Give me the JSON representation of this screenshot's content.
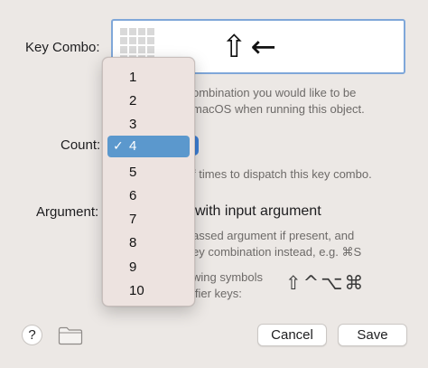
{
  "key_combo": {
    "label": "Key Combo:",
    "symbols": "⇧←",
    "help_lines": [
      "ombination you would like to be",
      "macOS when running this object."
    ]
  },
  "count": {
    "label": "Count:",
    "help": "f times to dispatch this key combo."
  },
  "argument": {
    "label": "Argument:",
    "checkbox_label": "with input argument",
    "help_lines": [
      "assed argument if present, and",
      "ey combination instead, e.g. ⌘S"
    ]
  },
  "symbols": {
    "help_lines": [
      "wing symbols",
      "ifier keys:"
    ],
    "glyphs": "⇧^⌥⌘"
  },
  "footer": {
    "help_label": "?",
    "cancel_label": "Cancel",
    "save_label": "Save"
  },
  "dropdown": {
    "options": [
      "1",
      "2",
      "3",
      "4",
      "5",
      "6",
      "7",
      "8",
      "9",
      "10"
    ],
    "selected": "4",
    "check_glyph": "✓"
  },
  "colors": {
    "selection": "#5b98cd",
    "focus_ring": "#7fa7d9",
    "stepper": "#3d7fd6"
  }
}
